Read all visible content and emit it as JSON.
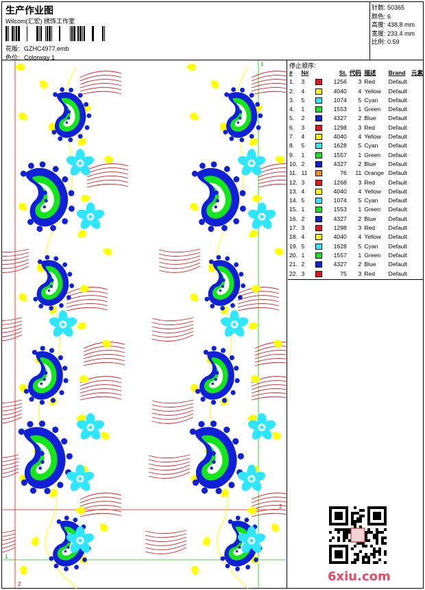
{
  "header": {
    "title": "生产作业图",
    "subtitle": "Wilcom(汇宏) 绣饰工作室",
    "design_label": "花版:",
    "design_value": "GZHC4977.emb",
    "colorway_label": "色位:",
    "colorway_value": "Colorway 1"
  },
  "stats": [
    {
      "label": "针数:",
      "value": "50365"
    },
    {
      "label": "颜色:",
      "value": "6"
    },
    {
      "label": "高度:",
      "value": "438.8 mm"
    },
    {
      "label": "宽度:",
      "value": "233.4 mm"
    },
    {
      "label": "比例:",
      "value": "0.59"
    }
  ],
  "legend": {
    "heading": "停止顺序:",
    "columns": [
      "#",
      "N#",
      "St.",
      "代码",
      "描述",
      "Brand",
      "元素"
    ],
    "rows": [
      {
        "n": "1.",
        "c": "3",
        "st": "1256",
        "code": "3",
        "desc": "Red",
        "brand": "Default",
        "color": "#e8141e"
      },
      {
        "n": "2.",
        "c": "4",
        "st": "4040",
        "code": "4",
        "desc": "Yellow",
        "brand": "Default",
        "color": "#ffff00"
      },
      {
        "n": "3.",
        "c": "5",
        "st": "1074",
        "code": "5",
        "desc": "Cyan",
        "brand": "Default",
        "color": "#2ee6ff"
      },
      {
        "n": "4.",
        "c": "1",
        "st": "1553",
        "code": "1",
        "desc": "Green",
        "brand": "Default",
        "color": "#13e61b"
      },
      {
        "n": "5.",
        "c": "2",
        "st": "4327",
        "code": "2",
        "desc": "Blue",
        "brand": "Default",
        "color": "#1020d8"
      },
      {
        "n": "6.",
        "c": "3",
        "st": "1298",
        "code": "3",
        "desc": "Red",
        "brand": "Default",
        "color": "#e8141e"
      },
      {
        "n": "7.",
        "c": "4",
        "st": "4040",
        "code": "4",
        "desc": "Yellow",
        "brand": "Default",
        "color": "#ffff00"
      },
      {
        "n": "8.",
        "c": "5",
        "st": "1628",
        "code": "5",
        "desc": "Cyan",
        "brand": "Default",
        "color": "#2ee6ff"
      },
      {
        "n": "9.",
        "c": "1",
        "st": "1557",
        "code": "1",
        "desc": "Green",
        "brand": "Default",
        "color": "#13e61b"
      },
      {
        "n": "10.",
        "c": "2",
        "st": "4327",
        "code": "2",
        "desc": "Blue",
        "brand": "Default",
        "color": "#1020d8"
      },
      {
        "n": "11.",
        "c": "11",
        "st": "76",
        "code": "11",
        "desc": "Orange",
        "brand": "Default",
        "color": "#f28a1e"
      },
      {
        "n": "12.",
        "c": "3",
        "st": "1268",
        "code": "3",
        "desc": "Red",
        "brand": "Default",
        "color": "#e8141e"
      },
      {
        "n": "13.",
        "c": "4",
        "st": "4040",
        "code": "4",
        "desc": "Yellow",
        "brand": "Default",
        "color": "#ffff00"
      },
      {
        "n": "14.",
        "c": "5",
        "st": "1074",
        "code": "5",
        "desc": "Cyan",
        "brand": "Default",
        "color": "#2ee6ff"
      },
      {
        "n": "15.",
        "c": "1",
        "st": "1553",
        "code": "1",
        "desc": "Green",
        "brand": "Default",
        "color": "#13e61b"
      },
      {
        "n": "16.",
        "c": "2",
        "st": "4327",
        "code": "2",
        "desc": "Blue",
        "brand": "Default",
        "color": "#1020d8"
      },
      {
        "n": "17.",
        "c": "3",
        "st": "1298",
        "code": "3",
        "desc": "Red",
        "brand": "Default",
        "color": "#e8141e"
      },
      {
        "n": "18.",
        "c": "4",
        "st": "4040",
        "code": "4",
        "desc": "Yellow",
        "brand": "Default",
        "color": "#ffff00"
      },
      {
        "n": "19.",
        "c": "5",
        "st": "1628",
        "code": "5",
        "desc": "Cyan",
        "brand": "Default",
        "color": "#2ee6ff"
      },
      {
        "n": "20.",
        "c": "1",
        "st": "1557",
        "code": "1",
        "desc": "Green",
        "brand": "Default",
        "color": "#13e61b"
      },
      {
        "n": "21.",
        "c": "2",
        "st": "4327",
        "code": "2",
        "desc": "Blue",
        "brand": "Default",
        "color": "#1020d8"
      },
      {
        "n": "22.",
        "c": "3",
        "st": "75",
        "code": "3",
        "desc": "Red",
        "brand": "Default",
        "color": "#e8141e"
      }
    ]
  },
  "guides": {
    "green_1": "1",
    "red_2": "2"
  },
  "footer": {
    "site": "6xiu.com"
  },
  "colors": {
    "red": "#e8141e",
    "yellow": "#ffff00",
    "cyan": "#2ee6ff",
    "green": "#13e61b",
    "blue": "#1020d8",
    "orange": "#f28a1e",
    "guide_red": "#ff0000",
    "guide_green": "#00d000"
  }
}
